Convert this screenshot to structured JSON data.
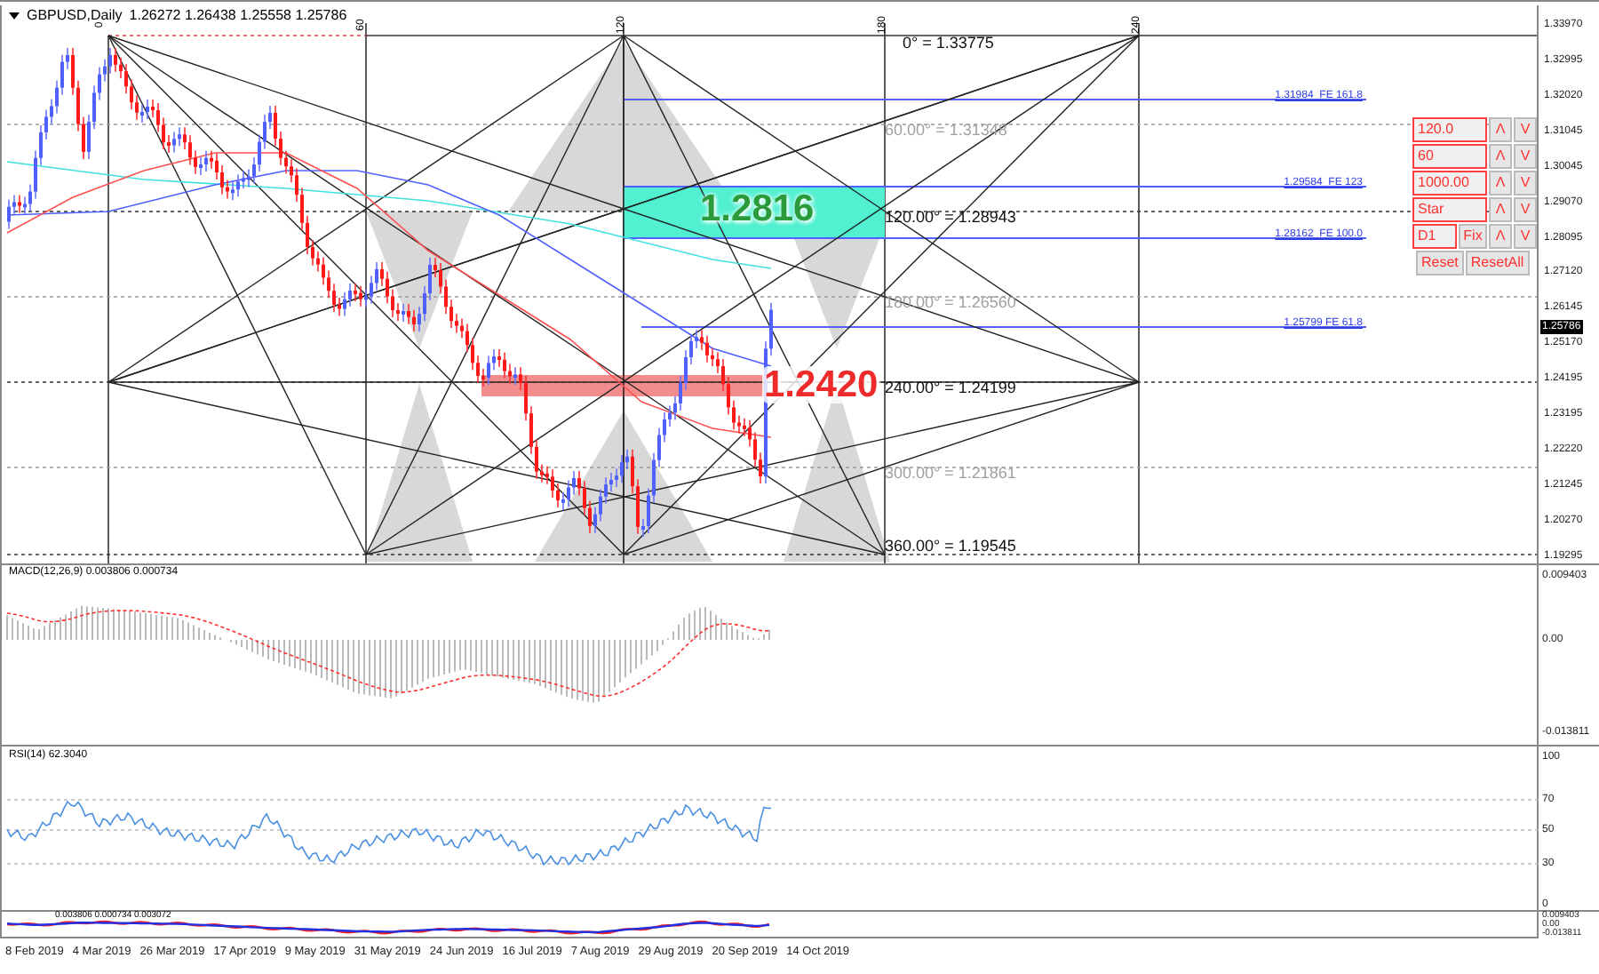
{
  "header": {
    "symbol": "GBPUSD,Daily",
    "quote": "1.26272 1.26438 1.25558 1.25786"
  },
  "gann_marks": [
    "0",
    "60",
    "120",
    "180",
    "240"
  ],
  "angle_levels": [
    {
      "text": "0° = 1.33775",
      "muted": false
    },
    {
      "text": "60.00° = 1.31348",
      "muted": true
    },
    {
      "text": "120.00° = 1.28943",
      "muted": false
    },
    {
      "text": "180.00° = 1.26560",
      "muted": true
    },
    {
      "text": "240.00° = 1.24199",
      "muted": false
    },
    {
      "text": "300.00° = 1.21861",
      "muted": true
    },
    {
      "text": "360.00° = 1.19545",
      "muted": false
    }
  ],
  "fe_levels": [
    "1.31984  FE 161.8",
    "1.29584  FE 123",
    "1.28162  FE 100.0",
    "1.25799 FE 61.8"
  ],
  "zones": [
    {
      "text": "1.2816",
      "kind": "resistance"
    },
    {
      "text": "1.2420",
      "kind": "support"
    }
  ],
  "control_panel": {
    "rows": [
      {
        "value": "120.0",
        "up": "Λ",
        "down": "V"
      },
      {
        "value": "60",
        "up": "Λ",
        "down": "V"
      },
      {
        "value": "1000.00",
        "up": "Λ",
        "down": "V"
      },
      {
        "value": "Star",
        "up": "Λ",
        "down": "V"
      },
      {
        "value": "D1",
        "fix": "Fix",
        "up": "Λ",
        "down": "V"
      }
    ],
    "buttons": [
      "Reset",
      "ResetAll"
    ]
  },
  "price_axis": {
    "labels": [
      "1.33970",
      "1.32995",
      "1.32020",
      "1.31045",
      "1.30045",
      "1.29070",
      "1.28095",
      "1.27120",
      "1.26145",
      "1.25170",
      "1.24195",
      "1.23195",
      "1.22220",
      "1.21245",
      "1.20270",
      "1.19295"
    ],
    "current": "1.25786"
  },
  "macd": {
    "label": "MACD(12,26,9) 0.003806 0.000734",
    "axis": [
      "0.009403",
      "0.00",
      "-0.013811"
    ]
  },
  "rsi": {
    "label": "RSI(14) 62.3040",
    "axis": [
      "100",
      "70",
      "50",
      "30",
      "0"
    ]
  },
  "oscillator": {
    "label": "0.003806 0.000734 0.003072",
    "axis": [
      "0.009403",
      "0.00",
      "-0.013811"
    ]
  },
  "dates": [
    "8 Feb 2019",
    "4 Mar 2019",
    "26 Mar 2019",
    "17 Apr 2019",
    "9 May 2019",
    "31 May 2019",
    "24 Jun 2019",
    "16 Jul 2019",
    "7 Aug 2019",
    "29 Aug 2019",
    "20 Sep 2019",
    "14 Oct 2019"
  ]
}
